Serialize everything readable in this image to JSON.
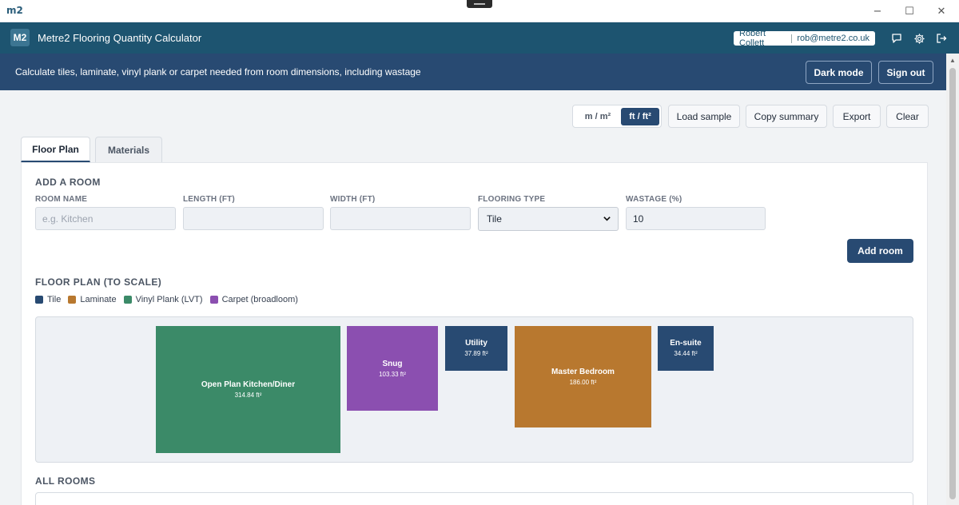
{
  "window": {
    "logo": "m2",
    "minimize": "−",
    "maximize": "☐",
    "close": "✕"
  },
  "app": {
    "badge": "M2",
    "title": "Metre2 Flooring Quantity Calculator"
  },
  "user": {
    "name": "Robert Collett",
    "email": "rob@metre2.co.uk"
  },
  "subheader": {
    "description": "Calculate tiles, laminate, vinyl plank or carpet needed from room dimensions, including wastage",
    "dark_mode": "Dark mode",
    "sign_out": "Sign out"
  },
  "toolbar": {
    "unit_metric": "m / m²",
    "unit_imperial": "ft / ft²",
    "load_sample": "Load sample",
    "copy_summary": "Copy summary",
    "export": "Export",
    "clear": "Clear"
  },
  "tabs": [
    {
      "label": "Floor Plan",
      "active": true
    },
    {
      "label": "Materials",
      "active": false
    }
  ],
  "add_room": {
    "heading": "ADD A ROOM",
    "room_name_label": "ROOM NAME",
    "room_name_placeholder": "e.g. Kitchen",
    "length_label": "LENGTH (FT)",
    "width_label": "WIDTH (FT)",
    "flooring_label": "FLOORING TYPE",
    "flooring_value": "Tile",
    "wastage_label": "WASTAGE (%)",
    "wastage_value": "10",
    "add_button": "Add room"
  },
  "floor_plan": {
    "heading": "FLOOR PLAN (TO SCALE)",
    "legend": [
      {
        "label": "Tile",
        "color": "#284a72"
      },
      {
        "label": "Laminate",
        "color": "#b8782f"
      },
      {
        "label": "Vinyl Plank (LVT)",
        "color": "#3b8a68"
      },
      {
        "label": "Carpet (broadloom)",
        "color": "#8b4fb0"
      }
    ],
    "rooms": [
      {
        "name": "Open Plan Kitchen/Diner",
        "area": "314.84 ft²",
        "type": "Vinyl Plank (LVT)",
        "color": "#3b8a68"
      },
      {
        "name": "Snug",
        "area": "103.33 ft²",
        "type": "Carpet (broadloom)",
        "color": "#8b4fb0"
      },
      {
        "name": "Utility",
        "area": "37.89 ft²",
        "type": "Tile",
        "color": "#284a72"
      },
      {
        "name": "Master Bedroom",
        "area": "186.00 ft²",
        "type": "Laminate",
        "color": "#b8782f"
      },
      {
        "name": "En-suite",
        "area": "34.44 ft²",
        "type": "Tile",
        "color": "#284a72"
      }
    ]
  },
  "all_rooms": {
    "heading": "ALL ROOMS"
  }
}
